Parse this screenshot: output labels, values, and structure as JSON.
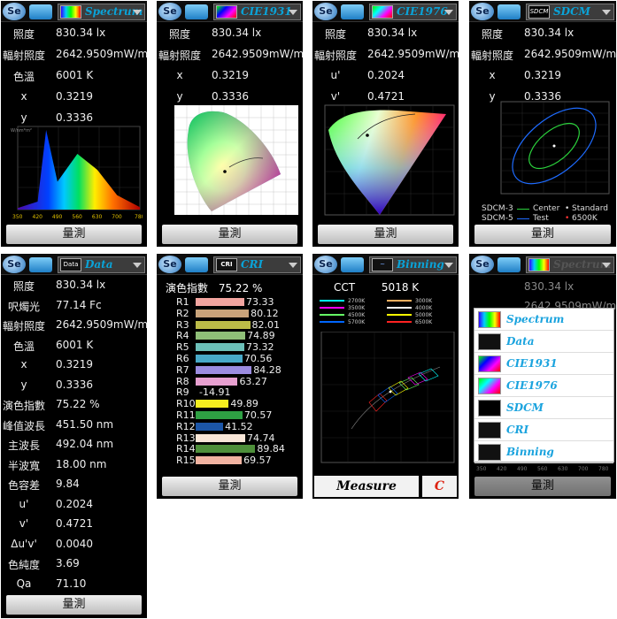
{
  "colors": {
    "accent": "#0aa3d8",
    "panel_bg": "#000000",
    "button_bg": "#d8d8d8"
  },
  "panels": {
    "spectrum": {
      "mode": "Spectrum",
      "icon": "spectrum-icon",
      "labels": [
        "照度",
        "輻射照度",
        "色溫",
        "x",
        "y"
      ],
      "values": [
        "830.34 lx",
        "2642.9509mW/m²",
        "6001 K",
        "0.3219",
        "0.3336"
      ],
      "button": "量測"
    },
    "cie1931": {
      "mode": "CIE1931",
      "labels": [
        "照度",
        "輻射照度",
        "x",
        "y"
      ],
      "values": [
        "830.34 lx",
        "2642.9509mW/m²",
        "0.3219",
        "0.3336"
      ],
      "button": "量測"
    },
    "cie1976": {
      "mode": "CIE1976",
      "labels": [
        "照度",
        "輻射照度",
        "u'",
        "v'"
      ],
      "values": [
        "830.34 lx",
        "2642.9509mW/m²",
        "0.2024",
        "0.4721"
      ],
      "button": "量測"
    },
    "sdcm": {
      "mode": "SDCM",
      "labels": [
        "照度",
        "輻射照度",
        "x",
        "y"
      ],
      "values": [
        "830.34 lx",
        "2642.9509mW/m²",
        "0.3219",
        "0.3336"
      ],
      "legend": [
        "SDCM-3",
        "Center",
        "Standard",
        "SDCM-5",
        "Test",
        "6500K"
      ],
      "button": "量測"
    },
    "data": {
      "mode": "Data",
      "labels": [
        "照度",
        "呎燭光",
        "輻射照度",
        "色溫",
        "x",
        "y",
        "演色指數",
        "峰值波長",
        "主波長",
        "半波寬",
        "色容差",
        "u'",
        "v'",
        "Δu'v'",
        "色純度",
        "Qa"
      ],
      "values": [
        "830.34 lx",
        "77.14 Fc",
        "2642.9509mW/m²",
        "6001 K",
        "0.3219",
        "0.3336",
        "75.22 %",
        "451.50 nm",
        "492.04 nm",
        "18.00 nm",
        "9.84",
        "0.2024",
        "0.4721",
        "0.0040",
        "3.69",
        "71.10"
      ],
      "button": "量測"
    },
    "cri": {
      "mode": "CRI",
      "header_label": "演色指數",
      "header_value": "75.22 %",
      "button": "量測"
    },
    "binning": {
      "mode": "Binning",
      "cct_label": "CCT",
      "cct_value": "5018 K",
      "legend": [
        "2700K",
        "3000K",
        "3500K",
        "4000K",
        "4500K",
        "5000K",
        "5700K",
        "6500K"
      ],
      "measure": "Measure",
      "c_button": "C"
    },
    "menu_panel": {
      "mode": "Spectrum",
      "value": "830.34 lx",
      "value2": "2642.9509mW/m²",
      "button": "量測",
      "axis": [
        "350",
        "420",
        "490",
        "560",
        "630",
        "700",
        "780"
      ]
    }
  },
  "menu_items": [
    "Spectrum",
    "Data",
    "CIE1931",
    "CIE1976",
    "SDCM",
    "CRI",
    "Binning"
  ],
  "chart_data": [
    {
      "type": "area",
      "title": "",
      "ylabel": "W/nm*m²",
      "x": [
        350,
        420,
        450,
        490,
        560,
        630,
        700,
        780
      ],
      "xlabel": "",
      "values": [
        0.02,
        0.1,
        1.0,
        0.35,
        0.7,
        0.5,
        0.18,
        0.03
      ],
      "ticks": [
        "350",
        "420",
        "490",
        "560",
        "630",
        "700",
        "780"
      ]
    },
    {
      "type": "bar",
      "title": "CRI",
      "categories": [
        "R1",
        "R2",
        "R3",
        "R4",
        "R5",
        "R6",
        "R7",
        "R8",
        "R9",
        "R10",
        "R11",
        "R12",
        "R13",
        "R14",
        "R15"
      ],
      "values": [
        73.33,
        80.12,
        82.01,
        74.89,
        73.32,
        70.56,
        84.28,
        63.27,
        -14.91,
        49.89,
        70.57,
        41.52,
        74.74,
        89.84,
        69.57
      ],
      "colors": [
        "#f3a5a0",
        "#c9a37a",
        "#bcbc48",
        "#8fbf78",
        "#6cc0b9",
        "#48a9c8",
        "#9b8ce0",
        "#e7a0d0",
        "#ee1c24",
        "#f5ee1f",
        "#2ea043",
        "#1c56a8",
        "#f8e6d8",
        "#4e8f3a",
        "#f1b3a1"
      ]
    }
  ]
}
